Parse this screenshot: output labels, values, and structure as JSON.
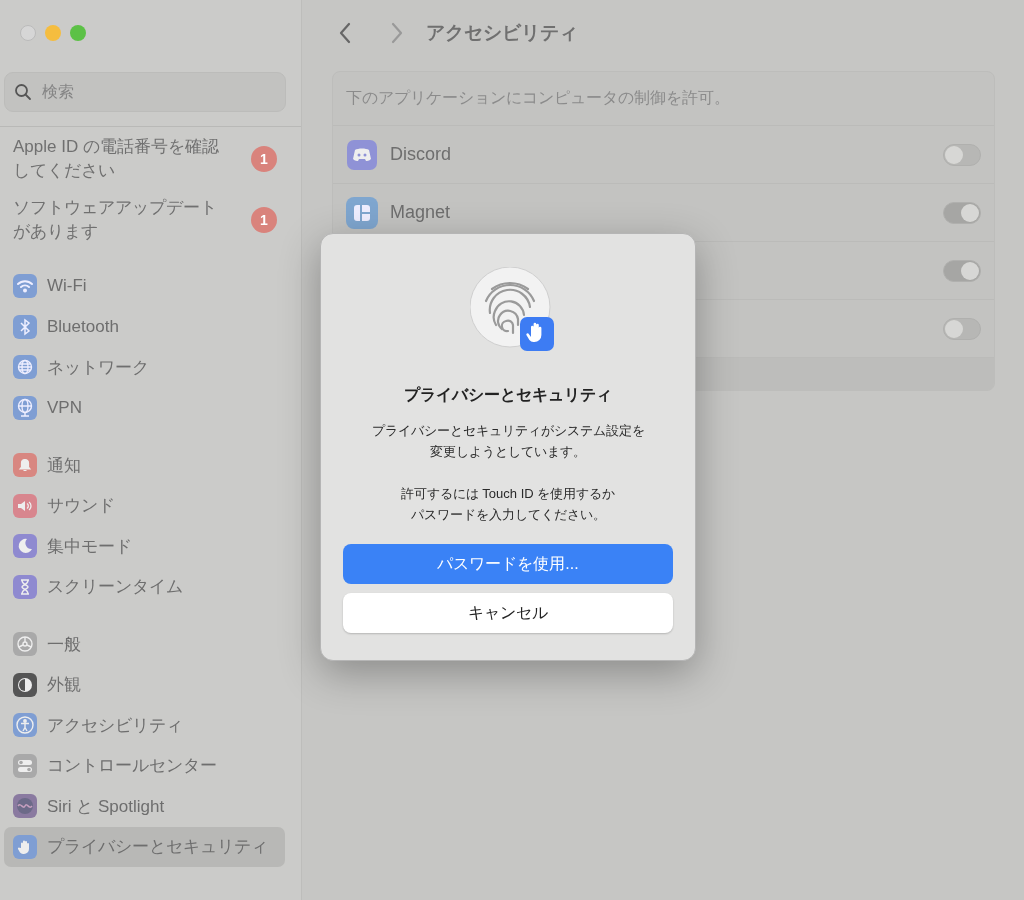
{
  "window": {
    "title": "アクセシビリティ"
  },
  "search": {
    "placeholder": "検索"
  },
  "notices": [
    {
      "text": "Apple ID の電話番号を確認してください",
      "badge": "1"
    },
    {
      "text": "ソフトウェアアップデートがあります",
      "badge": "1"
    }
  ],
  "sidebar": {
    "groups": [
      [
        {
          "label": "Wi-Fi",
          "kind": "wifi",
          "color": "#7f9ed3",
          "selected": false
        },
        {
          "label": "Bluetooth",
          "kind": "bluetooth",
          "color": "#7f9ed3",
          "selected": false
        },
        {
          "label": "ネットワーク",
          "kind": "globe",
          "color": "#7f9ed3",
          "selected": false
        },
        {
          "label": "VPN",
          "kind": "vpn",
          "color": "#7f9ed3",
          "selected": false
        }
      ],
      [
        {
          "label": "通知",
          "kind": "bell",
          "color": "#d88781",
          "selected": false
        },
        {
          "label": "サウンド",
          "kind": "sound",
          "color": "#d8868e",
          "selected": false
        },
        {
          "label": "集中モード",
          "kind": "moon",
          "color": "#8f8ad0",
          "selected": false
        },
        {
          "label": "スクリーンタイム",
          "kind": "hourglass",
          "color": "#8f8ad0",
          "selected": false
        }
      ],
      [
        {
          "label": "一般",
          "kind": "gear",
          "color": "#a9a9a9",
          "selected": false
        },
        {
          "label": "外観",
          "kind": "appearance",
          "color": "#555555",
          "selected": false
        },
        {
          "label": "アクセシビリティ",
          "kind": "person",
          "color": "#7f9ed3",
          "selected": false
        },
        {
          "label": "コントロールセンター",
          "kind": "switches",
          "color": "#a9a9a9",
          "selected": false
        },
        {
          "label": "Siri と Spotlight",
          "kind": "siri",
          "color": "#8a7aa0",
          "selected": false
        },
        {
          "label": "プライバシーとセキュリティ",
          "kind": "hand",
          "color": "#7f9ed3",
          "selected": true
        }
      ]
    ]
  },
  "card": {
    "caption": "下のアプリケーションにコンピュータの制御を許可。",
    "apps": [
      {
        "name": "Discord",
        "kind": "discord",
        "on": false
      },
      {
        "name": "Magnet",
        "kind": "magnet",
        "on": true
      },
      {
        "on": true
      },
      {
        "on": false
      }
    ]
  },
  "dialog": {
    "title": "プライバシーとセキュリティ",
    "message": "プライバシーとセキュリティがシステム設定を変更しようとしています。",
    "hint": "許可するには Touch ID を使用するかパスワードを入力してください。",
    "buttons": [
      {
        "label": "パスワードを使用...",
        "kind": "primary"
      },
      {
        "label": "キャンセル",
        "kind": "secondary"
      }
    ]
  }
}
